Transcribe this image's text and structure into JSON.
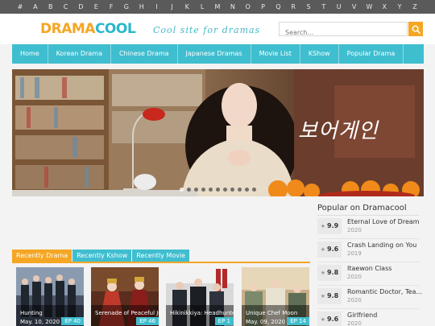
{
  "alphabet": [
    "#",
    "A",
    "B",
    "C",
    "D",
    "E",
    "F",
    "G",
    "H",
    "I",
    "J",
    "K",
    "L",
    "M",
    "N",
    "O",
    "P",
    "Q",
    "R",
    "S",
    "T",
    "U",
    "V",
    "W",
    "X",
    "Y",
    "Z"
  ],
  "header": {
    "logo_part1": "DRAMA",
    "logo_part2": "COOL",
    "tagline": "Cool site for dramas",
    "search_placeholder": "Search..."
  },
  "nav": [
    "Home",
    "Korean Drama",
    "Chinese Drama",
    "Japanese Dramas",
    "Movie List",
    "KShow",
    "Popular Drama"
  ],
  "banner": {
    "overlay_text": "보어게인",
    "slide_count": 11,
    "active_slide": 1
  },
  "tabs": [
    {
      "label": "Recently Drama",
      "active": true
    },
    {
      "label": "Recently Kshow",
      "active": false
    },
    {
      "label": "Recently Movie",
      "active": false
    }
  ],
  "recent": [
    {
      "title": "Hunting",
      "date": "May. 10, 2020",
      "ep": "EP 40"
    },
    {
      "title": "Serenade of Peaceful Joy",
      "date": "",
      "ep": "EP 46"
    },
    {
      "title": "Hikinikkiya: Headhunter no R",
      "date": "",
      "ep": "EP 1"
    },
    {
      "title": "Unique Chef Moon",
      "date": "May. 09, 2020",
      "ep": "EP 14"
    }
  ],
  "popular": {
    "heading": "Popular on Dramacool",
    "items": [
      {
        "score": "9.9",
        "name": "Eternal Love of Dream",
        "year": "2020"
      },
      {
        "score": "9.6",
        "name": "Crash Landing on You",
        "year": "2019"
      },
      {
        "score": "9.8",
        "name": "Itaewon Class",
        "year": "2020"
      },
      {
        "score": "9.8",
        "name": "Romantic Doctor, Tea...",
        "year": "2020"
      },
      {
        "score": "9.6",
        "name": "Girlfriend",
        "year": "2020"
      }
    ]
  },
  "colors": {
    "accent": "#3fbecf",
    "orange": "#f5a623",
    "alpha_bar": "#5a5a5a"
  },
  "icons": {
    "search": "search-icon",
    "star": "star-icon"
  }
}
